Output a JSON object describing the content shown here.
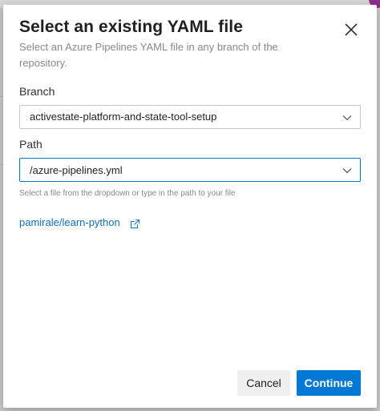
{
  "dialog": {
    "title": "Select an existing YAML file",
    "subtitle": "Select an Azure Pipelines YAML file in any branch of the repository.",
    "close_icon": "close-icon"
  },
  "branch": {
    "label": "Branch",
    "value": "activestate-platform-and-state-tool-setup",
    "icon": "chevron-down-icon"
  },
  "path": {
    "label": "Path",
    "value": "/azure-pipelines.yml",
    "icon": "chevron-down-icon",
    "helper": "Select a file from the dropdown or type in the path to your file"
  },
  "repository": {
    "link_text": "pamirale/learn-python",
    "icon": "external-link-icon"
  },
  "actions": {
    "cancel_label": "Cancel",
    "continue_label": "Continue"
  },
  "colors": {
    "accent": "#0078d4",
    "link": "#0f6cbd"
  }
}
